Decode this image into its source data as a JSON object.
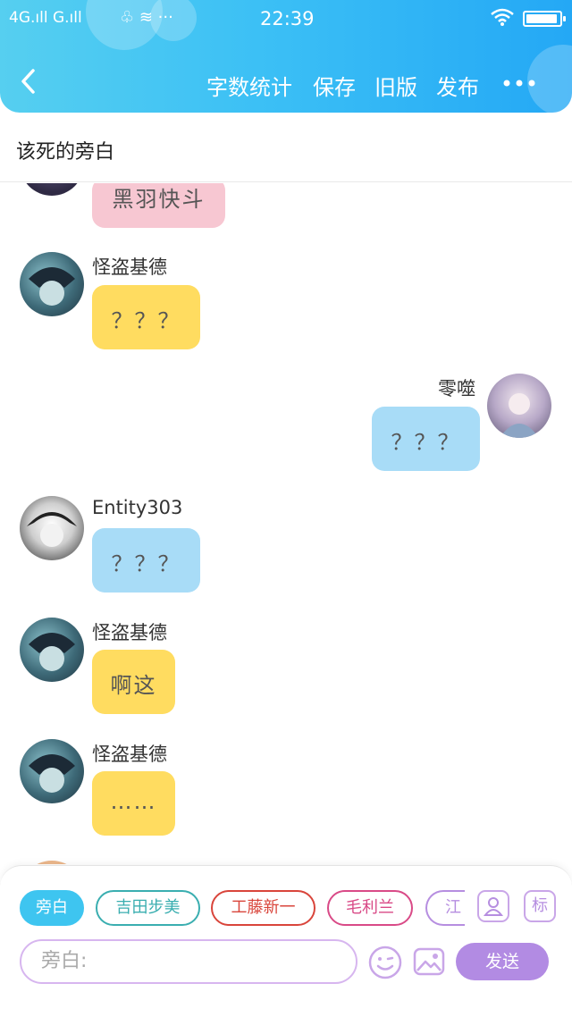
{
  "status": {
    "network": "4G.ıll G.ıll",
    "icons": "♧ ≋ ···",
    "time": "22:39",
    "battery_level": 0.95
  },
  "header": {
    "back_icon": "chevron-left-icon",
    "nav": [
      {
        "label": "字数统计"
      },
      {
        "label": "保存"
      },
      {
        "label": "旧版"
      },
      {
        "label": "发布"
      }
    ],
    "more_icon": "ellipsis-icon"
  },
  "title": "该死的旁白",
  "messages": [
    {
      "sender": "",
      "text": "黑羽快斗",
      "side": "left",
      "color": "#f7c7d2"
    },
    {
      "sender": "怪盗基德",
      "text": "？？？",
      "side": "left",
      "color": "#ffdc60"
    },
    {
      "sender": "零噬",
      "text": "？？？",
      "side": "right",
      "color": "#a8dcf7"
    },
    {
      "sender": "Entity303",
      "text": "？？？",
      "side": "left",
      "color": "#a8dcf7"
    },
    {
      "sender": "怪盗基德",
      "text": "啊这",
      "side": "left",
      "color": "#ffdc60"
    },
    {
      "sender": "怪盗基德",
      "text": "……",
      "side": "left",
      "color": "#ffdc60"
    }
  ],
  "roles": [
    {
      "label": "旁白",
      "color": "#3ec5f0",
      "active": true
    },
    {
      "label": "吉田步美",
      "color": "#3aaeb0"
    },
    {
      "label": "工藤新一",
      "color": "#d9453b"
    },
    {
      "label": "毛利兰",
      "color": "#d94a87"
    },
    {
      "label": "江",
      "color": "#b68ee0"
    }
  ],
  "tools": {
    "person_icon": "person-card-icon",
    "mark_label": "标"
  },
  "input": {
    "placeholder": "旁白:",
    "emoji_icon": "emoji-icon",
    "image_icon": "image-icon",
    "send_label": "发送"
  }
}
